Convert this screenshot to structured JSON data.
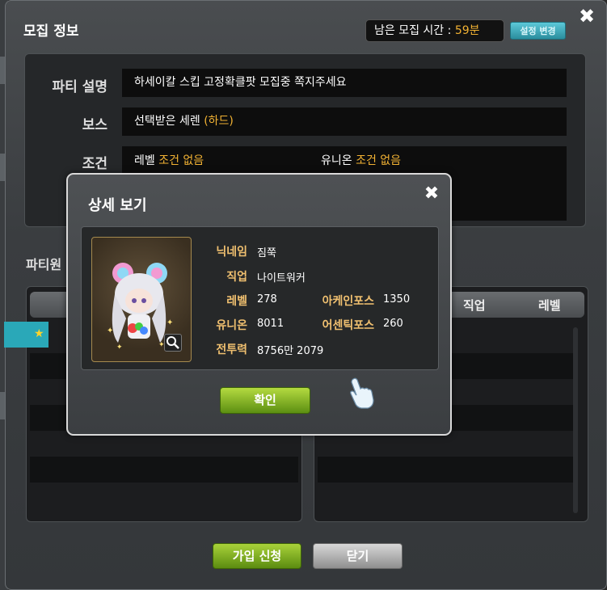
{
  "window": {
    "title": "모집 정보",
    "timer_label": "남은 모집 시간 :",
    "timer_value": "59분",
    "settings_button": "설정 변경",
    "close_symbol": "✖"
  },
  "info": {
    "description_label": "파티 설명",
    "description_value": "하세이칼 스킵 고정확클팟 모집중 쪽지주세요",
    "boss_label": "보스",
    "boss_value": "선택받은 세렌",
    "boss_difficulty": "(하드)",
    "conditions_label": "조건",
    "level_label": "레벨",
    "level_value": "조건 없음",
    "union_label": "유니온",
    "union_value": "조건 없음"
  },
  "party": {
    "section_title": "파티원",
    "right_columns": [
      "직업",
      "레벨"
    ]
  },
  "buttons": {
    "apply": "가입 신청",
    "close": "닫기"
  },
  "popup": {
    "title": "상세 보기",
    "close_symbol": "✖",
    "nickname_label": "닉네임",
    "nickname_value": "짐쭉",
    "job_label": "직업",
    "job_value": "나이트워커",
    "level_label": "레벨",
    "level_value": "278",
    "arcane_label": "아케인포스",
    "arcane_value": "1350",
    "union_label": "유니온",
    "union_value": "8011",
    "authentic_label": "어센틱포스",
    "authentic_value": "260",
    "power_label": "전투력",
    "power_value": "8756만 2079",
    "confirm_button": "확인"
  },
  "colors": {
    "accent_orange": "#f2b233",
    "label_gold": "#f0c070",
    "button_green": "#8bbd26",
    "button_teal": "#3ab0c0"
  }
}
